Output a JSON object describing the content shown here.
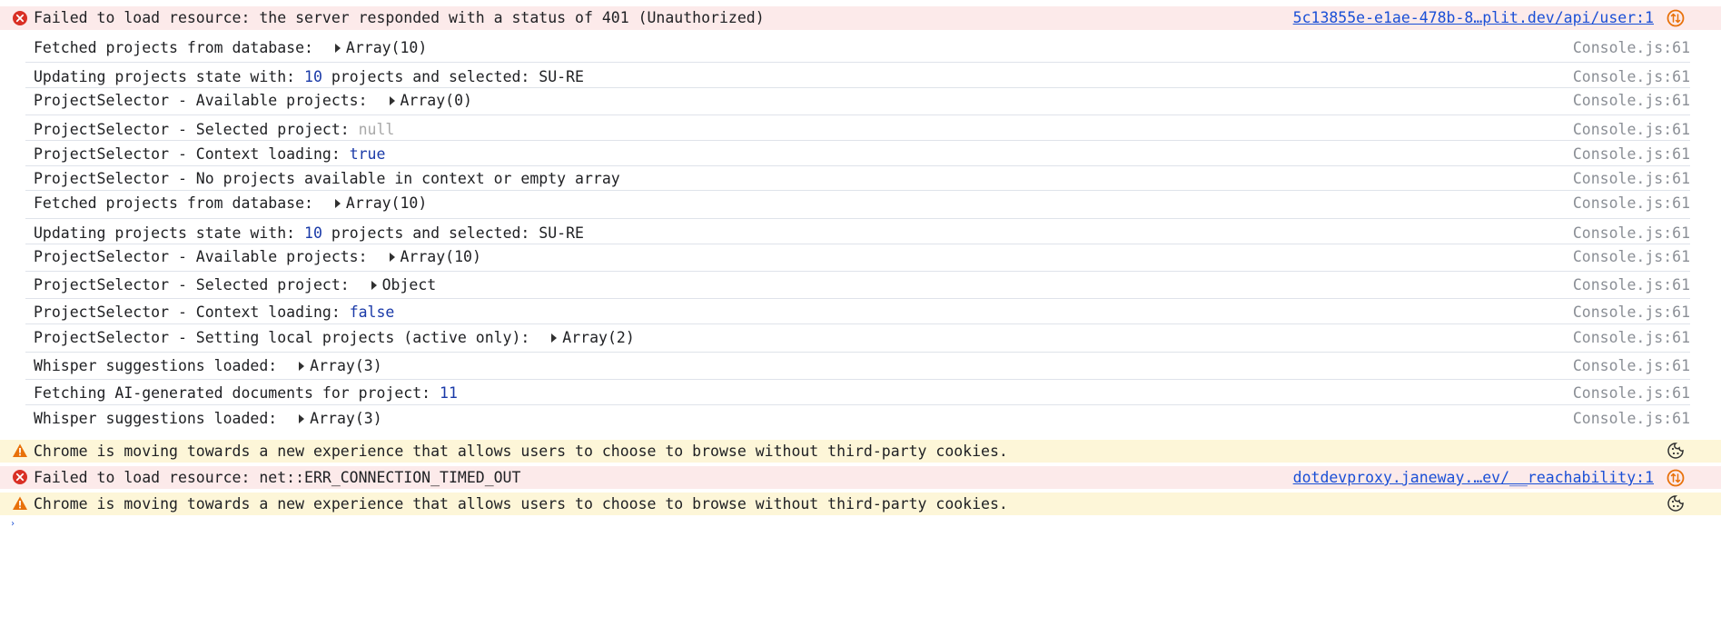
{
  "console": {
    "rows": [
      {
        "type": "error",
        "text": "Failed to load resource: the server responded with a status of 401 (Unauthorized)",
        "source": "5c13855e-e1ae-478b-8…plit.dev/api/user:1"
      },
      {
        "type": "log",
        "text": "Fetched projects from database: ",
        "obj": "Array(10)",
        "source": "Console.js:61"
      },
      {
        "type": "log",
        "pre": "Updating projects state with: ",
        "num": "10",
        "post": " projects and selected: SU-RE",
        "source": "Console.js:61"
      },
      {
        "type": "log",
        "text": "ProjectSelector - Available projects: ",
        "obj": "Array(0)",
        "source": "Console.js:61"
      },
      {
        "type": "log",
        "text": "ProjectSelector - Selected project: ",
        "null": "null",
        "source": "Console.js:61"
      },
      {
        "type": "log",
        "text": "ProjectSelector - Context loading: ",
        "kw": "true",
        "source": "Console.js:61"
      },
      {
        "type": "log",
        "text": "ProjectSelector - No projects available in context or empty array",
        "source": "Console.js:61"
      },
      {
        "type": "log",
        "text": "Fetched projects from database: ",
        "obj": "Array(10)",
        "source": "Console.js:61"
      },
      {
        "type": "log",
        "pre": "Updating projects state with: ",
        "num": "10",
        "post": " projects and selected: SU-RE",
        "source": "Console.js:61"
      },
      {
        "type": "log",
        "text": "ProjectSelector - Available projects: ",
        "obj": "Array(10)",
        "source": "Console.js:61"
      },
      {
        "type": "log",
        "text": "ProjectSelector - Selected project: ",
        "obj": "Object",
        "source": "Console.js:61"
      },
      {
        "type": "log",
        "text": "ProjectSelector - Context loading: ",
        "kw": "false",
        "source": "Console.js:61"
      },
      {
        "type": "log",
        "text": "ProjectSelector - Setting local projects (active only): ",
        "obj": "Array(2)",
        "source": "Console.js:61"
      },
      {
        "type": "log",
        "text": "Whisper suggestions loaded: ",
        "obj": "Array(3)",
        "source": "Console.js:61"
      },
      {
        "type": "log",
        "text": "Fetching AI-generated documents for project: ",
        "num": "11",
        "source": "Console.js:61"
      },
      {
        "type": "log",
        "text": "Whisper suggestions loaded: ",
        "obj": "Array(3)",
        "source": "Console.js:61"
      },
      {
        "type": "warning",
        "text": "Chrome is moving towards a new experience that allows users to choose to browse without third-party cookies."
      },
      {
        "type": "error",
        "text": "Failed to load resource: net::ERR_CONNECTION_TIMED_OUT",
        "source": "dotdevproxy.janeway.…ev/__reachability:1"
      },
      {
        "type": "warning",
        "text": "Chrome is moving towards a new experience that allows users to choose to browse without third-party cookies."
      }
    ],
    "icons": {
      "error": "error-circle-icon",
      "warning": "warning-triangle-icon",
      "network": "network-request-icon",
      "cookie": "cookie-icon"
    },
    "colors": {
      "error_bg": "#fceaea",
      "warning_bg": "#fdf6d8",
      "error_icon": "#d93025",
      "warning_icon": "#e8710a",
      "link": "#1a4fd6",
      "number": "#1a3aa8"
    }
  }
}
